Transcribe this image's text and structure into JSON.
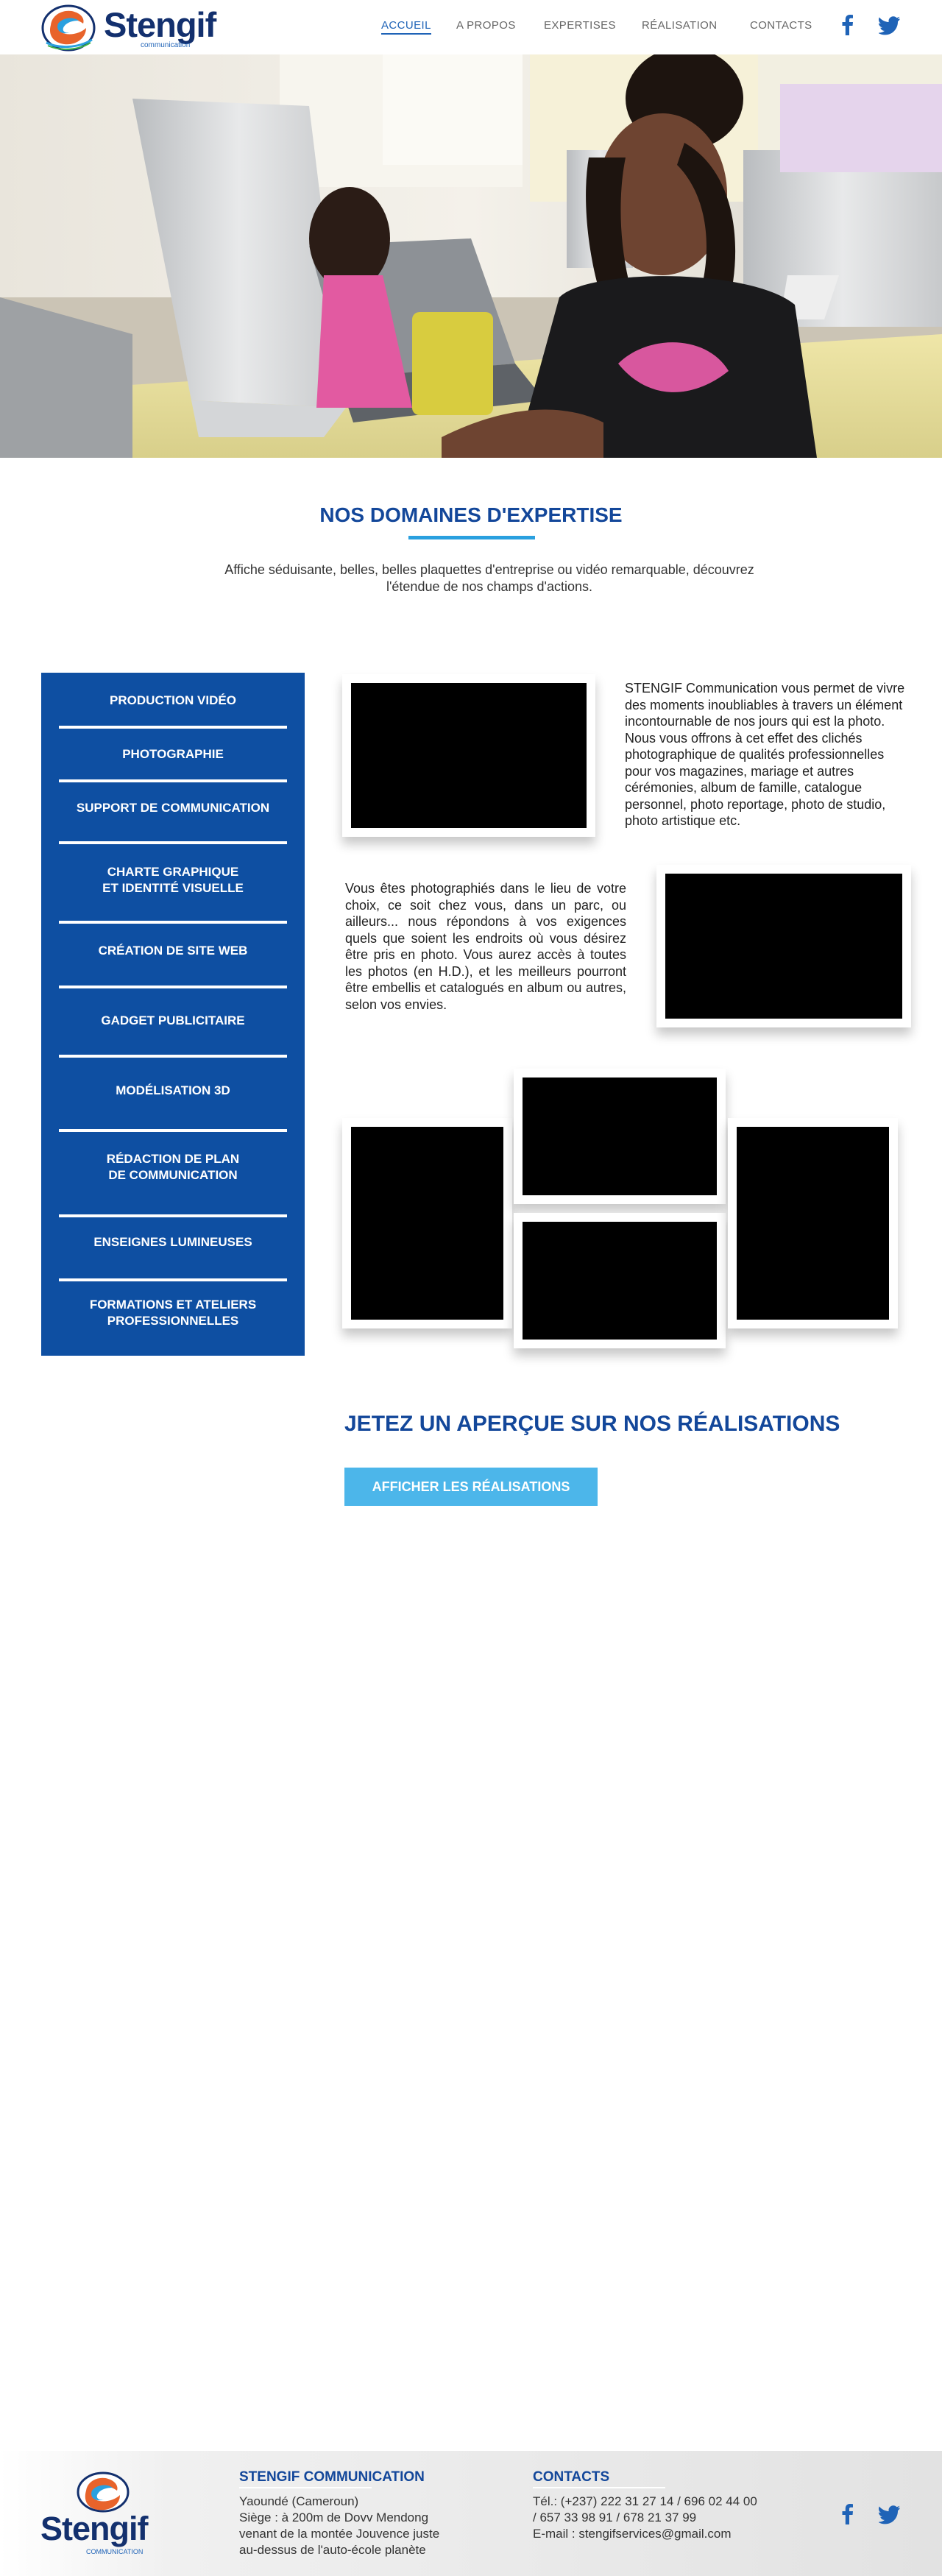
{
  "brand": {
    "name": "Stengif",
    "tagline": "communication",
    "colors": {
      "primary": "#0e4fa2",
      "accent": "#2aa0df",
      "button": "#4cb6ea",
      "dark": "#13306e"
    }
  },
  "nav": {
    "items": [
      {
        "label": "ACCUEIL",
        "active": true
      },
      {
        "label": "A PROPOS",
        "active": false
      },
      {
        "label": "EXPERTISES",
        "active": false
      },
      {
        "label": "RÉALISATION",
        "active": false
      },
      {
        "label": "CONTACTS",
        "active": false
      }
    ],
    "social": [
      "facebook-icon",
      "twitter-icon"
    ]
  },
  "expertise": {
    "title": "NOS DOMAINES D'EXPERTISE",
    "subtitle": "Affiche séduisante, belles, belles plaquettes d'entreprise ou vidéo remarquable, découvrez l'étendue de nos champs d'actions."
  },
  "sidebar": {
    "items": [
      "PRODUCTION VIDÉO",
      "PHOTOGRAPHIE",
      "SUPPORT DE COMMUNICATION",
      "CHARTE GRAPHIQUE\nET IDENTITÉ VISUELLE",
      "CRÉATION DE SITE WEB",
      "GADGET PUBLICITAIRE",
      "MODÉLISATION 3D",
      "RÉDACTION DE PLAN\nDE COMMUNICATION",
      "ENSEIGNES LUMINEUSES",
      "FORMATIONS ET ATELIERS\nPROFESSIONNELLES"
    ]
  },
  "content": {
    "paragraph1": "STENGIF Communication vous permet de vivre des moments inoubliables à travers un élément incontournable de nos jours qui est la photo. Nous vous offrons à cet effet des clichés photographique de qualités professionnelles pour vos magazines, mariage et autres cérémonies, album de famille, catalogue personnel, photo reportage, photo de studio, photo artistique etc.",
    "paragraph2": "Vous êtes photographiés dans le lieu de votre choix, ce soit chez vous, dans un parc, ou ailleurs... nous répondons à vos exigences quels que soient les endroits où vous désirez être pris en photo. Vous aurez accès à toutes les photos (en H.D.), et les meilleurs pourront être embellis et catalogués en album ou autres, selon vos envies."
  },
  "realisations": {
    "title": "JETEZ UN APERÇUE SUR NOS RÉALISATIONS",
    "button": "AFFICHER LES RÉALISATIONS"
  },
  "footer": {
    "company_title": "STENGIF COMMUNICATION",
    "address": "Yaoundé (Cameroun)\nSiège : à 200m de Dovv Mendong\nvenant de la montée Jouvence juste\nau-dessus de l'auto-école planète",
    "contacts_title": "CONTACTS",
    "contacts": "Tél.: (+237) 222 31 27 14 / 696 02 44 00\n/ 657 33 98 91 / 678 21 37 99\nE-mail : stengifservices@gmail.com",
    "logo_word": "Stengif",
    "logo_sub": "COMMUNICATION"
  }
}
